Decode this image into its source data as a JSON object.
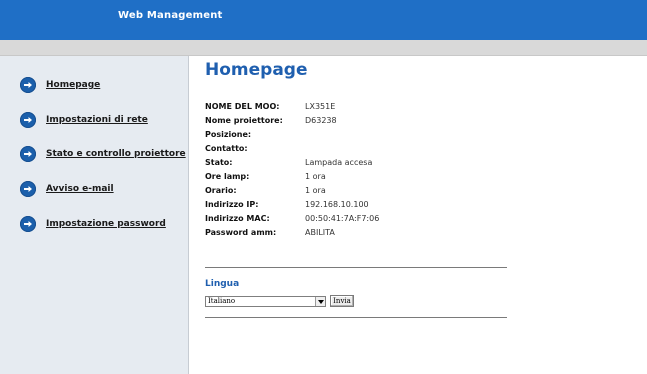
{
  "header": {
    "title": "Web Management"
  },
  "sidebar": {
    "items": [
      {
        "label": "Homepage",
        "icon": "arrow-right-circle-icon"
      },
      {
        "label": "Impostazioni di rete",
        "icon": "arrow-right-circle-icon"
      },
      {
        "label": "Stato e controllo proiettore",
        "icon": "arrow-right-circle-icon"
      },
      {
        "label": "Avviso e-mail",
        "icon": "arrow-right-circle-icon"
      },
      {
        "label": "Impostazione password",
        "icon": "arrow-right-circle-icon"
      }
    ]
  },
  "main": {
    "title": "Homepage",
    "info": [
      {
        "label": "NOME DEL MOO:",
        "value": "LX351E"
      },
      {
        "label": "Nome proiettore:",
        "value": "D63238"
      },
      {
        "label": "Posizione:",
        "value": ""
      },
      {
        "label": "Contatto:",
        "value": ""
      },
      {
        "label": "Stato:",
        "value": "Lampada accesa"
      },
      {
        "label": "Ore lamp:",
        "value": "1 ora"
      },
      {
        "label": "Orario:",
        "value": "1 ora"
      },
      {
        "label": "Indirizzo IP:",
        "value": "192.168.10.100"
      },
      {
        "label": "Indirizzo MAC:",
        "value": "00:50:41:7A:F7:06"
      },
      {
        "label": "Password amm:",
        "value": "ABILITA"
      }
    ],
    "language": {
      "label": "Lingua",
      "selected": "Italiano",
      "submit_label": "Invia"
    }
  },
  "colors": {
    "header_bg": "#1f6fc6",
    "sidebar_bg": "#e6ebf1",
    "accent_title": "#1f5faf",
    "icon_bg": "#1b5fab"
  }
}
